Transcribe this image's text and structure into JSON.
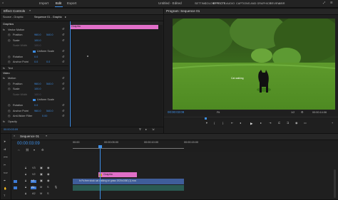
{
  "topbar": {
    "workspaces": [
      "Import",
      "Edit",
      "Export"
    ],
    "active_workspace": "Edit",
    "doc_title": "Untitled - Edited",
    "tabs": [
      "SETTING",
      "COLOR",
      "EFFECTS",
      "AUDIO",
      "CAPTIONS AND GRAPHICS",
      "REVIEW",
      "LIBR"
    ],
    "active_tab": "EFFECTS"
  },
  "effect_controls": {
    "title": "Effect Controls",
    "source_label": "Source - Graphic",
    "sequence_label": "Sequence 01 - Graphic",
    "mini_clip_label": "Graphic",
    "sections": [
      {
        "label": "Graphics",
        "indent": 0
      },
      {
        "label": "Vector Motion",
        "indent": 1
      },
      {
        "label": "Position",
        "indent": 2,
        "value": "960.0",
        "value2": "540.0"
      },
      {
        "label": "Scale",
        "indent": 2,
        "value": "100.0"
      },
      {
        "label": "Scale Width",
        "indent": 2,
        "value": "100.0",
        "dim": true
      },
      {
        "label": "Uniform Scale",
        "indent": 2,
        "checkbox": true
      },
      {
        "label": "Rotation",
        "indent": 2,
        "value": "0.0"
      },
      {
        "label": "Anchor Point",
        "indent": 2,
        "value": "0.0",
        "value2": "0.0"
      },
      {
        "label": "Text",
        "indent": 1
      },
      {
        "label": "Video",
        "indent": 0
      },
      {
        "label": "Motion",
        "indent": 1
      },
      {
        "label": "Position",
        "indent": 2,
        "value": "960.0",
        "value2": "540.0"
      },
      {
        "label": "Scale",
        "indent": 2,
        "value": "100.0"
      },
      {
        "label": "Scale Width",
        "indent": 2,
        "value": "100.0",
        "dim": true
      },
      {
        "label": "Uniform Scale",
        "indent": 2,
        "checkbox": true
      },
      {
        "label": "Rotation",
        "indent": 2,
        "value": "0.0"
      },
      {
        "label": "Anchor Point",
        "indent": 2,
        "value": "960.0",
        "value2": "540.0"
      },
      {
        "label": "Anti-flicker Filter",
        "indent": 2,
        "value": "0.00"
      },
      {
        "label": "Opacity",
        "indent": 1
      }
    ],
    "timecode": "00:00:03:09"
  },
  "program_monitor": {
    "title": "Program: Sequence 01",
    "timecode": "00:00:03:09",
    "fit": "Fit",
    "resolution": "1/2",
    "duration": "00:00:14:06",
    "overlay_text": "Cat walking"
  },
  "timeline": {
    "title": "Sequence 01",
    "timecode": "00:00:03:09",
    "ruler": [
      "00:00",
      "00:00:05:00",
      "00:00:10:00",
      "00:00:15:00"
    ],
    "tracks": [
      "V3",
      "V2",
      "V1",
      "A1",
      "A2"
    ],
    "graphic_clip": "Graphic",
    "video_clip": "fx Pu:free stock cat walking on grass 1920x1080 (1).mov"
  }
}
